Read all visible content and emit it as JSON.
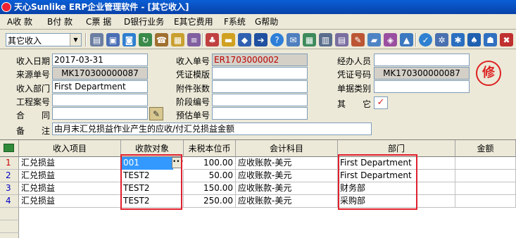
{
  "window": {
    "title": "天心Sunlike ERP企业管理软件 - [其它收入]"
  },
  "menu": [
    {
      "label": "A收 款"
    },
    {
      "label": "B付 款"
    },
    {
      "label": "C票 据"
    },
    {
      "label": "D银行业务"
    },
    {
      "label": "E其它费用"
    },
    {
      "label": "F系统"
    },
    {
      "label": "G帮助"
    }
  ],
  "toolbar": {
    "doc_type_value": "其它收入",
    "icons": [
      "print-icon",
      "save-icon",
      "monitor-icon",
      "refresh-icon",
      "phone-icon",
      "document-icon",
      "list-icon",
      "briefcase-icon",
      "stamp-icon",
      "people-icon",
      "folder-icon",
      "bookmark-icon",
      "arrow-icon",
      "help-icon",
      "mail-icon",
      "calendar-icon",
      "grid-icon",
      "table-icon",
      "check-icon",
      "gear-icon",
      "node-icon",
      "tree-icon",
      "network-icon",
      "exit-icon"
    ]
  },
  "form": {
    "receipt_date_label": "收入日期",
    "receipt_date": "2017-03-31",
    "source_no_label": "来源单号",
    "source_no": "MK170300000087",
    "dept_label": "收入部门",
    "dept": "First Department",
    "project_no_label": "工程案号",
    "project_no": "",
    "contract_label": "合　　同",
    "contract": "",
    "memo_label": "备　　注",
    "memo": "由月末汇兑损益作业产生的应收/付汇兑损益金额",
    "receipt_no_label": "收入单号",
    "receipt_no": "ER1703000002",
    "voucher_tpl_label": "凭证模版",
    "voucher_tpl": "",
    "attachments_label": "附件张数",
    "attachments": "",
    "stage_no_label": "阶段编号",
    "stage_no": "",
    "estimate_no_label": "预估单号",
    "estimate_no": "",
    "handler_label": "经办人员",
    "handler": "",
    "voucher_no_label": "凭证号码",
    "voucher_no": "MK170300000087",
    "doc_category_label": "单据类别",
    "doc_category": "",
    "other_label": "其　　它",
    "other_check": "✓",
    "stamp_text": "修"
  },
  "grid": {
    "columns": [
      "收入项目",
      "收款对象",
      "未税本位币",
      "会计科目",
      "部门",
      "金额"
    ],
    "rows": [
      {
        "no": "1",
        "item": "汇兑损益",
        "target": "001",
        "amount": "100.00",
        "account": "应收账款-美元",
        "dept": "First Department"
      },
      {
        "no": "2",
        "item": "汇兑损益",
        "target": "TEST2",
        "amount": "50.00",
        "account": "应收账款-美元",
        "dept": "First Department"
      },
      {
        "no": "3",
        "item": "汇兑损益",
        "target": "TEST2",
        "amount": "150.00",
        "account": "应收账款-美元",
        "dept": "财务部"
      },
      {
        "no": "4",
        "item": "汇兑损益",
        "target": "TEST2",
        "amount": "250.00",
        "account": "应收账款-美元",
        "dept": "采购部"
      }
    ]
  },
  "colors": {
    "highlight_box": "#e0202e",
    "selected_cell": "#3399ff",
    "title_bar": "#0a5fd6"
  }
}
